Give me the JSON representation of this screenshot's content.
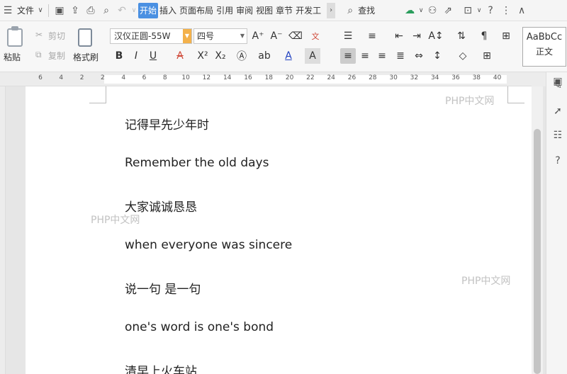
{
  "menubar": {
    "file_label": "文件",
    "tabs": [
      "开始",
      "插入",
      "页面布局",
      "引用",
      "审阅",
      "视图",
      "章节",
      "开发工具"
    ],
    "active_tab": "开始",
    "search_label": "查找"
  },
  "ribbon": {
    "paste_label": "粘贴",
    "cut_label": "剪切",
    "copy_label": "复制",
    "format_painter_label": "格式刷",
    "font_name": "汉仪正圆-55W",
    "font_size": "四号",
    "style_sample": "AaBbCc",
    "style_name": "正文"
  },
  "ruler": {
    "labels": [
      "6",
      "4",
      "2",
      "2",
      "4",
      "6",
      "8",
      "10",
      "12",
      "14",
      "16",
      "18",
      "20",
      "22",
      "24",
      "26",
      "28",
      "30",
      "32",
      "34",
      "36",
      "38",
      "40"
    ]
  },
  "document": {
    "lines": [
      "记得早先少年时",
      "Remember the old days",
      "大家诚诚恳恳",
      "when everyone was sincere",
      "说一句  是一句",
      "one's word is one's bond",
      "清早上火车站"
    ],
    "watermark": "PHP中文网"
  },
  "colors": {
    "active_tab_bg": "#4a90e2",
    "font_dropdown_accent": "#f3b14b"
  }
}
